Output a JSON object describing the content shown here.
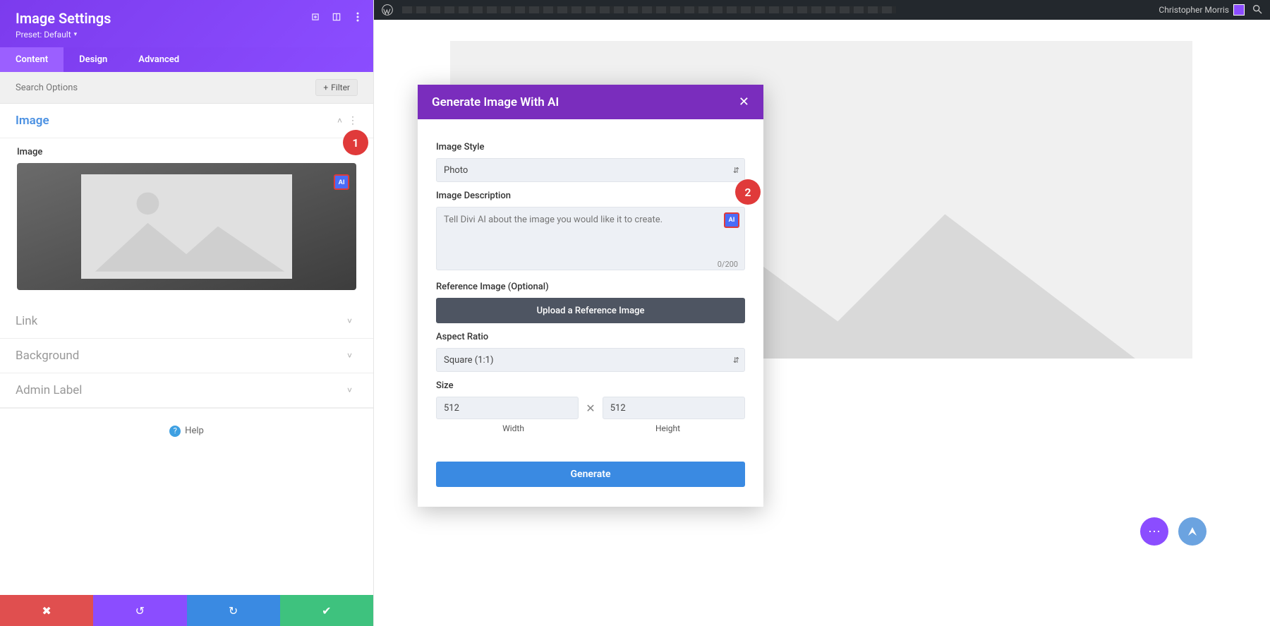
{
  "sidebar": {
    "title": "Image Settings",
    "preset": "Preset: Default",
    "tabs": {
      "content": "Content",
      "design": "Design",
      "advanced": "Advanced"
    },
    "search_placeholder": "Search Options",
    "filter_label": "Filter",
    "sections": {
      "image_title": "Image",
      "image_label": "Image",
      "link_title": "Link",
      "background_title": "Background",
      "admin_title": "Admin Label"
    },
    "ai_badge": "AI",
    "help": "Help"
  },
  "wpbar": {
    "user": "Christopher Morris"
  },
  "modal": {
    "title": "Generate Image With AI",
    "style_label": "Image Style",
    "style_value": "Photo",
    "desc_label": "Image Description",
    "desc_placeholder": "Tell Divi AI about the image you would like it to create.",
    "count": "0/200",
    "ref_label": "Reference Image (Optional)",
    "upload_btn": "Upload a Reference Image",
    "aspect_label": "Aspect Ratio",
    "aspect_value": "Square (1:1)",
    "size_label": "Size",
    "width": "512",
    "height": "512",
    "width_label": "Width",
    "height_label": "Height",
    "generate": "Generate",
    "ai_badge": "AI"
  },
  "callouts": {
    "one": "1",
    "two": "2"
  }
}
